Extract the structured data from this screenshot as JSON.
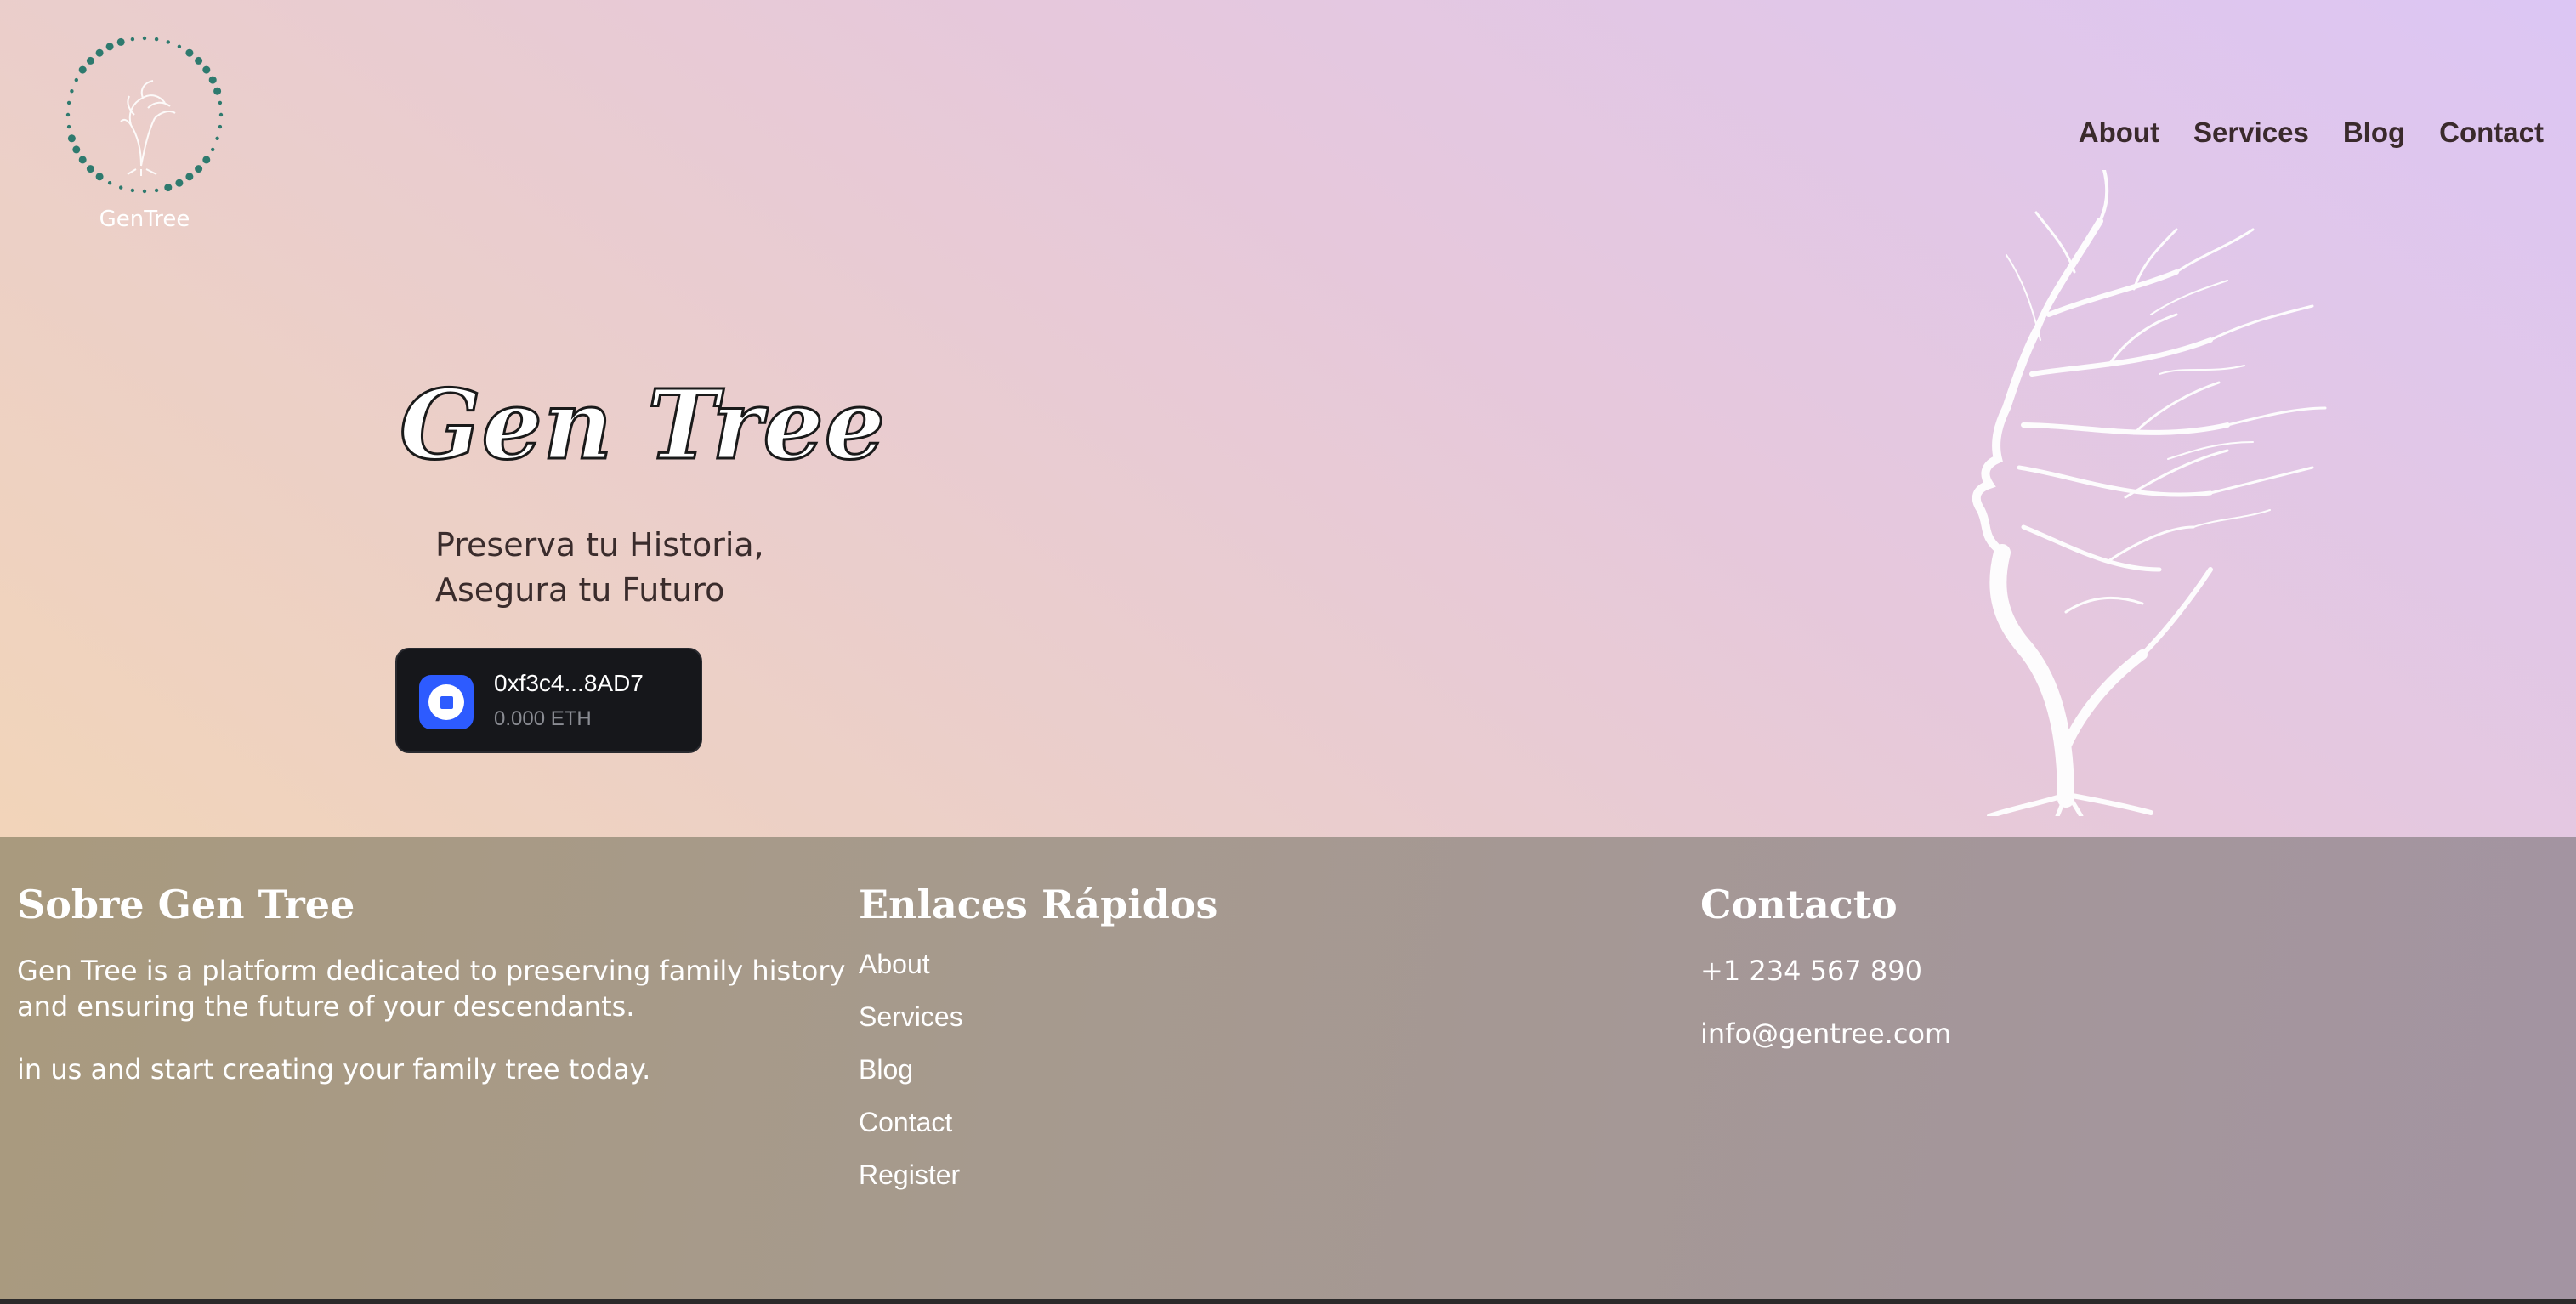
{
  "header": {
    "logo_text": "GenTree",
    "nav": [
      "About",
      "Services",
      "Blog",
      "Contact"
    ]
  },
  "hero": {
    "title": "Gen Tree",
    "tagline_line1": "Preserva tu Historia,",
    "tagline_line2": "Asegura tu Futuro"
  },
  "wallet": {
    "address": "0xf3c4...8AD7",
    "balance": "0.000 ETH",
    "icon": "coinbase-wallet-icon"
  },
  "footer": {
    "about": {
      "title": "Sobre Gen Tree",
      "text1": "Gen Tree is a platform dedicated to preserving family history and ensuring the future of your descendants.",
      "text2": "in us and start creating your family tree today."
    },
    "links": {
      "title": "Enlaces Rápidos",
      "items": [
        "About",
        "Services",
        "Blog",
        "Contact",
        "Register"
      ]
    },
    "contact": {
      "title": "Contacto",
      "phone": "+1 234 567 890",
      "email": "info@gentree.com"
    }
  },
  "colors": {
    "logo_dots": "#2e7a6e",
    "wallet_bg": "#16171b",
    "wallet_accent": "#2d5bff",
    "nav_text": "#3a2a2c"
  }
}
